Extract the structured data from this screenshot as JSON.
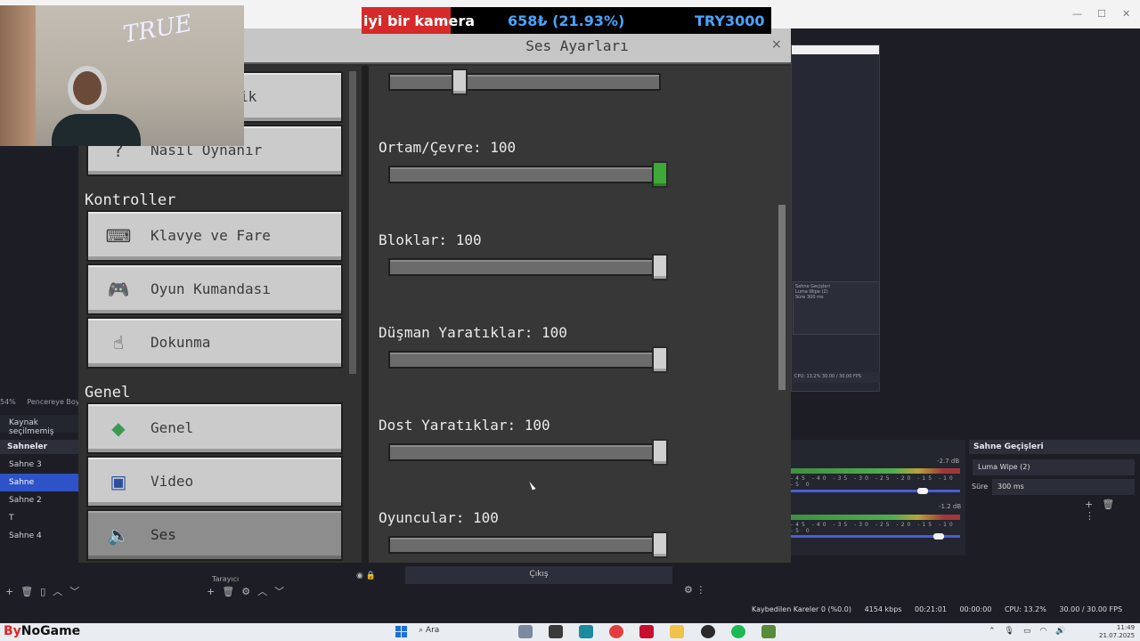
{
  "obs": {
    "left_status": [
      "54%",
      "Pencereye Boyu"
    ],
    "source_status": "Kaynak seçilmemiş",
    "scenes_header": "Sahneler",
    "scenes": [
      {
        "label": "Sahne 3",
        "active": false
      },
      {
        "label": "Sahne",
        "active": true
      },
      {
        "label": "Sahne 2",
        "active": false
      },
      {
        "label": "T",
        "active": false
      },
      {
        "label": "Sahne 4",
        "active": false
      }
    ],
    "source_item": "Tarayıcı",
    "exit_button": "Çıkış",
    "audio_db": [
      "-2.7 dB",
      "-1.2 dB"
    ],
    "meter_ticks": "-45 -40 -35 -30 -25 -20 -15 -10 -5 0",
    "transitions_header": "Sahne Geçişleri",
    "transition_value": "Luma Wipe (2)",
    "duration_label": "Süre",
    "duration_value": "300 ms",
    "statusbar": {
      "dropped": "Kaybedilen Kareler 0 (%0.0)",
      "bitrate": "4154 kbps",
      "live_time": "00:21:01",
      "rec_time": "00:00:00",
      "cpu": "CPU: 13.2%",
      "fps": "30.00 / 30.00 FPS"
    },
    "mini_panel": [
      "Sahne Geçişleri",
      "Luma Wipe (2)",
      "Süre   300 ms"
    ],
    "mini_status": "CPU: 13.2%   30.00 / 30.00 FPS"
  },
  "alert": {
    "text1": "iyi bir kamera",
    "text2": "658₺ (21.93%)",
    "text3": "TRY3000"
  },
  "webcam": {
    "graffiti": "TRUE"
  },
  "mc": {
    "title": "Ses Ayarları",
    "close": "×",
    "nav_top_partial": "ik",
    "nav_howto": "Nasıl Oynanır",
    "section_controls": "Kontroller",
    "nav_keyboard": "Klavye ve Fare",
    "nav_controller": "Oyun Kumandası",
    "nav_touch": "Dokunma",
    "section_general": "Genel",
    "nav_general": "Genel",
    "nav_video": "Video",
    "nav_sound": "Ses",
    "sliders": [
      {
        "label": "",
        "value": 0.24
      },
      {
        "label": "Ortam/Çevre: 100",
        "value": 1.0
      },
      {
        "label": "Bloklar: 100",
        "value": 1.0
      },
      {
        "label": "Düşman Yaratıklar: 100",
        "value": 1.0
      },
      {
        "label": "Dost Yaratıklar: 100",
        "value": 1.0
      },
      {
        "label": "Oyuncular: 100",
        "value": 1.0
      }
    ]
  },
  "taskbar": {
    "brand_a": "By",
    "brand_b": "NoGame",
    "search": "Ara",
    "time": "11:49",
    "date": "21.07.2025"
  }
}
